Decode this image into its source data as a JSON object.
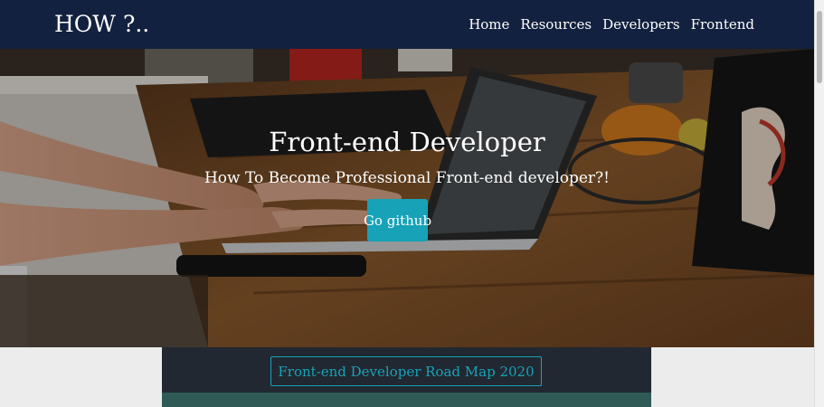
{
  "navbar": {
    "brand": "HOW ?..",
    "links": [
      {
        "label": "Home"
      },
      {
        "label": "Resources"
      },
      {
        "label": "Developers"
      },
      {
        "label": "Frontend"
      }
    ]
  },
  "hero": {
    "title": "Front-end Developer",
    "subtitle": "How To Become Professional Front-end developer?!",
    "button_label": "Go github"
  },
  "roadmap": {
    "button_label": "Front-end Developer Road Map 2020"
  },
  "colors": {
    "navbar_bg": "#12213f",
    "accent": "#17a2b8",
    "section_bg": "#222831",
    "strip_bg": "#2f5a55"
  }
}
